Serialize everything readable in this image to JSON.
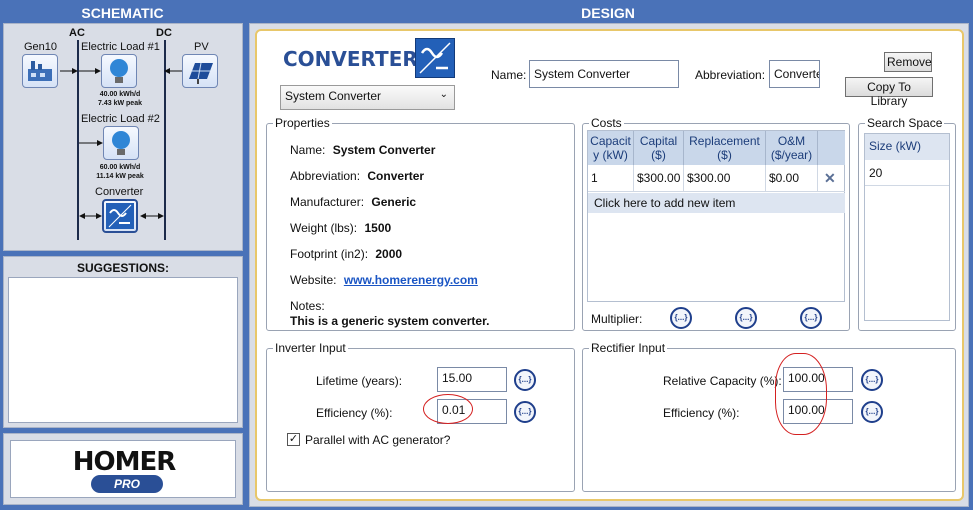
{
  "headers": {
    "schematic": "SCHEMATIC",
    "design": "DESIGN"
  },
  "schematic": {
    "bus_ac": "AC",
    "bus_dc": "DC",
    "gen_label": "Gen10",
    "pv_label": "PV",
    "load1_label": "Electric Load #1",
    "load1_kwh": "40.00 kWh/d",
    "load1_peak": "7.43 kW peak",
    "load2_label": "Electric Load #2",
    "load2_kwh": "60.00 kWh/d",
    "load2_peak": "11.14 kW peak",
    "converter_label": "Converter"
  },
  "suggestions": {
    "title": "SUGGESTIONS:"
  },
  "logo": {
    "text": "HOMER",
    "sub": "PRO"
  },
  "design": {
    "title": "CONVERTER",
    "name_label": "Name:",
    "name_value": "System Converter",
    "abbr_label": "Abbreviation:",
    "abbr_value": "Converte",
    "remove_btn": "Remove",
    "copy_btn": "Copy To Library",
    "select_value": "System Converter"
  },
  "properties": {
    "title": "Properties",
    "name_label": "Name:",
    "name_value": "System Converter",
    "abbr_label": "Abbreviation:",
    "abbr_value": "Converter",
    "manufacturer_label": "Manufacturer:",
    "manufacturer_value": "Generic",
    "weight_label": "Weight (lbs):",
    "weight_value": "1500",
    "footprint_label": "Footprint (in2):",
    "footprint_value": "2000",
    "website_label": "Website:",
    "website_value": "www.homerenergy.com",
    "notes_label": "Notes:",
    "notes_value": "This is a generic system converter."
  },
  "costs": {
    "title": "Costs",
    "columns": [
      "Capacit y (kW)",
      "Capital ($)",
      "Replacement ($)",
      "O&M ($/year)"
    ],
    "rows": [
      [
        "1",
        "$300.00",
        "$300.00",
        "$0.00"
      ]
    ],
    "add_item": "Click here to add new item",
    "multiplier_label": "Multiplier:"
  },
  "search_space": {
    "title": "Search Space",
    "column": "Size (kW)",
    "values": [
      "20"
    ]
  },
  "inverter": {
    "title": "Inverter Input",
    "lifetime_label": "Lifetime (years):",
    "lifetime_value": "15.00",
    "efficiency_label": "Efficiency (%):",
    "efficiency_value": "0.01",
    "parallel_label": "Parallel with AC generator?",
    "parallel_checked": true
  },
  "rectifier": {
    "title": "Rectifier Input",
    "capacity_label": "Relative Capacity (%):",
    "capacity_value": "100.00",
    "efficiency_label": "Efficiency (%):",
    "efficiency_value": "100.00"
  },
  "ellipsis": "{...}",
  "colors": {
    "accent": "#4a72b8",
    "title_blue": "#2a4f96",
    "annotation_red": "#d42020"
  }
}
